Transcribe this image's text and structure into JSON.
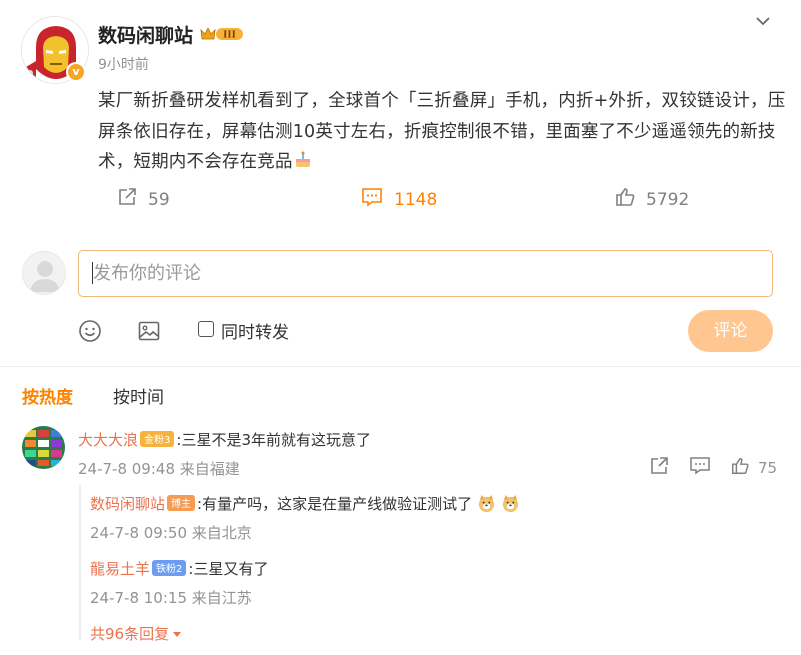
{
  "post": {
    "author": "数码闲聊站",
    "level_badge": "III",
    "time": "9小时前",
    "text": "某厂新折叠研发样机看到了，全球首个「三折叠屏」手机，内折+外折，双铰链设计，压屏条依旧存在，屏幕估测10英寸左右，折痕控制很不错，里面塞了不少遥遥领先的新技术，短期内不会存在竞品",
    "verified_mark": "v",
    "actions": {
      "repost_count": "59",
      "comment_count": "1148",
      "like_count": "5792"
    }
  },
  "composer": {
    "placeholder": "发布你的评论",
    "repost_label": "同时转发",
    "submit_label": "评论"
  },
  "sort_tabs": {
    "hot": "按热度",
    "time": "按时间"
  },
  "comments": [
    {
      "user": "大大大浪",
      "badge": "金粉3",
      "text": ":三星不是3年前就有这玩意了",
      "meta": "24-7-8 09:48 来自福建",
      "like_count": "75",
      "replies": [
        {
          "user": "数码闲聊站",
          "badge": "博主",
          "text": ":有量产吗，这家是在量产线做验证测试了",
          "meta": "24-7-8 09:50 来自北京"
        },
        {
          "user": "龍易土羊",
          "badge": "铁粉2",
          "text": ":三星又有了",
          "meta": "24-7-8 10:15 来自江苏"
        }
      ],
      "more_replies": "共96条回复"
    }
  ],
  "colors": {
    "accent": "#ff8200",
    "username": "#eb7350",
    "submit_disabled": "#ffc68f",
    "muted": "#939393"
  },
  "icons": [
    "chevron-down-icon",
    "repost-icon",
    "comment-icon",
    "like-icon",
    "emoji-icon",
    "image-icon",
    "report-icon",
    "reply-icon",
    "caret-down-icon"
  ]
}
